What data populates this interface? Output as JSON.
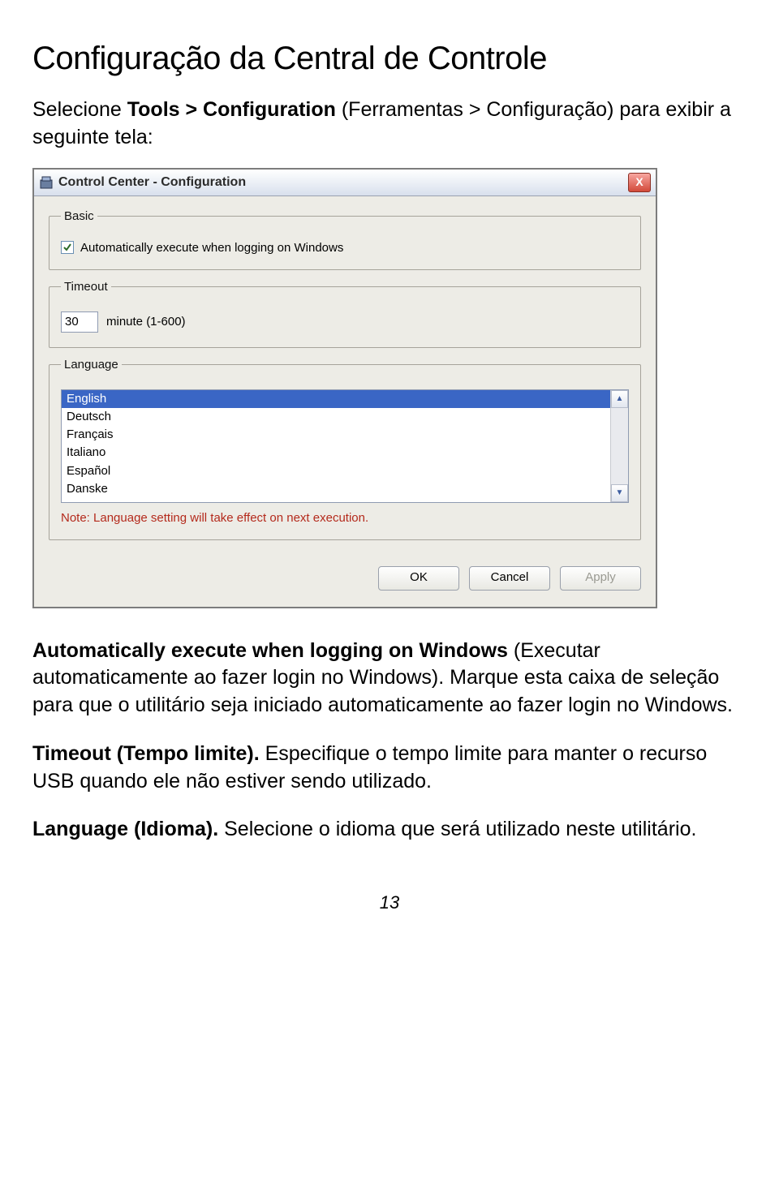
{
  "heading": "Configuração da Central de Controle",
  "intro_prefix": "Selecione ",
  "intro_bold": "Tools > Configuration",
  "intro_suffix": " (Ferramentas > Configuração) para exibir a seguinte tela:",
  "dialog": {
    "title": "Control Center - Configuration",
    "close_glyph": "X",
    "basic": {
      "legend": "Basic",
      "checkbox_label": "Automatically execute when logging on Windows",
      "checked": true
    },
    "timeout": {
      "legend": "Timeout",
      "value": "30",
      "unit_label": "minute (1-600)"
    },
    "language": {
      "legend": "Language",
      "items": [
        "English",
        "Deutsch",
        "Français",
        "Italiano",
        "Español",
        "Danske"
      ],
      "selected_index": 0,
      "note": "Note: Language setting will take effect on next execution."
    },
    "buttons": {
      "ok": "OK",
      "cancel": "Cancel",
      "apply": "Apply"
    }
  },
  "p1_bold": "Automatically execute when logging on Windows",
  "p1_rest": " (Executar automaticamente ao fazer login no Windows). Marque esta caixa de seleção para que o utilitário seja iniciado automaticamente ao fazer login no Windows.",
  "p2_bold": "Timeout (Tempo limite).",
  "p2_rest": " Especifique o tempo limite para manter o recurso USB quando ele não estiver sendo utilizado.",
  "p3_bold": "Language (Idioma).",
  "p3_rest": " Selecione o idioma que será utilizado neste utilitário.",
  "page_number": "13"
}
